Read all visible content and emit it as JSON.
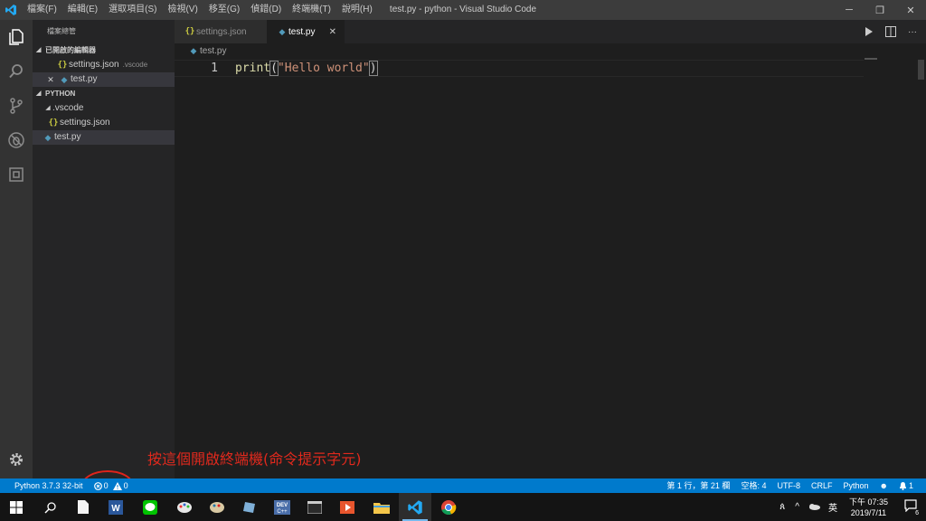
{
  "titlebar": {
    "menu": [
      "檔案(F)",
      "編輯(E)",
      "選取項目(S)",
      "檢視(V)",
      "移至(G)",
      "偵錯(D)",
      "終端機(T)",
      "說明(H)"
    ],
    "title": "test.py - python - Visual Studio Code",
    "controls": {
      "minimize": "─",
      "restore": "❐",
      "close": "✕"
    }
  },
  "activitybar": {
    "icons": [
      "explorer-icon",
      "search-icon",
      "source-control-icon",
      "debug-icon",
      "extensions-icon"
    ],
    "bottom_icon": "gear-icon"
  },
  "sidebar": {
    "title": "檔案總管",
    "open_editors": {
      "label": "已開啟的編輯器",
      "items": [
        {
          "name": "settings.json",
          "desc": ".vscode",
          "icon": "json-icon"
        },
        {
          "name": "test.py",
          "desc": "",
          "icon": "python-icon"
        }
      ]
    },
    "workspace": {
      "label": "PYTHON",
      "items": [
        {
          "name": ".vscode",
          "type": "folder"
        },
        {
          "name": "settings.json",
          "type": "json"
        },
        {
          "name": "test.py",
          "type": "python"
        }
      ]
    }
  },
  "tabs": [
    {
      "label": "settings.json",
      "icon": "json-icon",
      "active": false
    },
    {
      "label": "test.py",
      "icon": "python-icon",
      "active": true,
      "close": "✕"
    }
  ],
  "breadcrumb": "test.py",
  "editor": {
    "line_number": "1",
    "tokens": {
      "fn": "print",
      "open": "(",
      "str": "\"Hello world\"",
      "close": ")"
    }
  },
  "annotation": "按這個開啟終端機(命令提示字元)",
  "statusbar": {
    "interpreter": "Python 3.7.3 32-bit",
    "errors": "0",
    "warnings": "0",
    "position": "第 1 行，第 21 欄",
    "spaces": "空格: 4",
    "encoding": "UTF-8",
    "eol": "CRLF",
    "language": "Python",
    "notifications": "1"
  },
  "taskbar": {
    "time": "下午 07:35",
    "date": "2019/7/11",
    "ime": "英",
    "notification_count": "6"
  },
  "colors": {
    "accent": "#007acc",
    "annotation_red": "#e0291d"
  }
}
